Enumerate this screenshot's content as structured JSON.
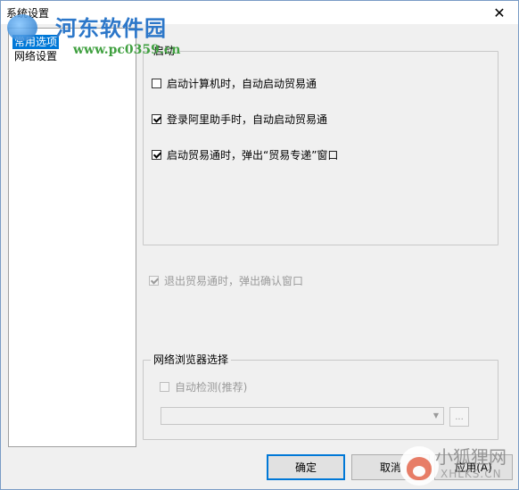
{
  "window": {
    "title": "系统设置",
    "close_symbol": "✕"
  },
  "watermark_top": {
    "title": "河东软件园",
    "url": "www.pc0359.cn"
  },
  "tree": {
    "items": [
      {
        "label": "常用选项",
        "selected": true
      },
      {
        "label": "网络设置",
        "selected": false
      }
    ]
  },
  "startup_group": {
    "title": "启动",
    "options": [
      {
        "label": "启动计算机时，自动启动贸易通",
        "checked": false
      },
      {
        "label": "登录阿里助手时，自动启动贸易通",
        "checked": true
      },
      {
        "label": "启动贸易通时，弹出“贸易专递”窗口",
        "checked": true
      }
    ]
  },
  "exit_option": {
    "label": "退出贸易通时，弹出确认窗口",
    "checked": true,
    "disabled": true
  },
  "browser_group": {
    "title": "网络浏览器选择",
    "auto_detect": {
      "label": "自动检测(推荐)",
      "checked": false,
      "disabled": true
    },
    "select_value": "",
    "browse_label": "..."
  },
  "buttons": {
    "ok": "确定",
    "cancel": "取消",
    "apply": "应用(A)"
  },
  "watermark_bottom": {
    "title": "小狐狸网",
    "url": "XHLKS.CN"
  },
  "colors": {
    "selection": "#0078d7",
    "watermark_blue": "#2c77c9",
    "watermark_green": "#40a040"
  }
}
